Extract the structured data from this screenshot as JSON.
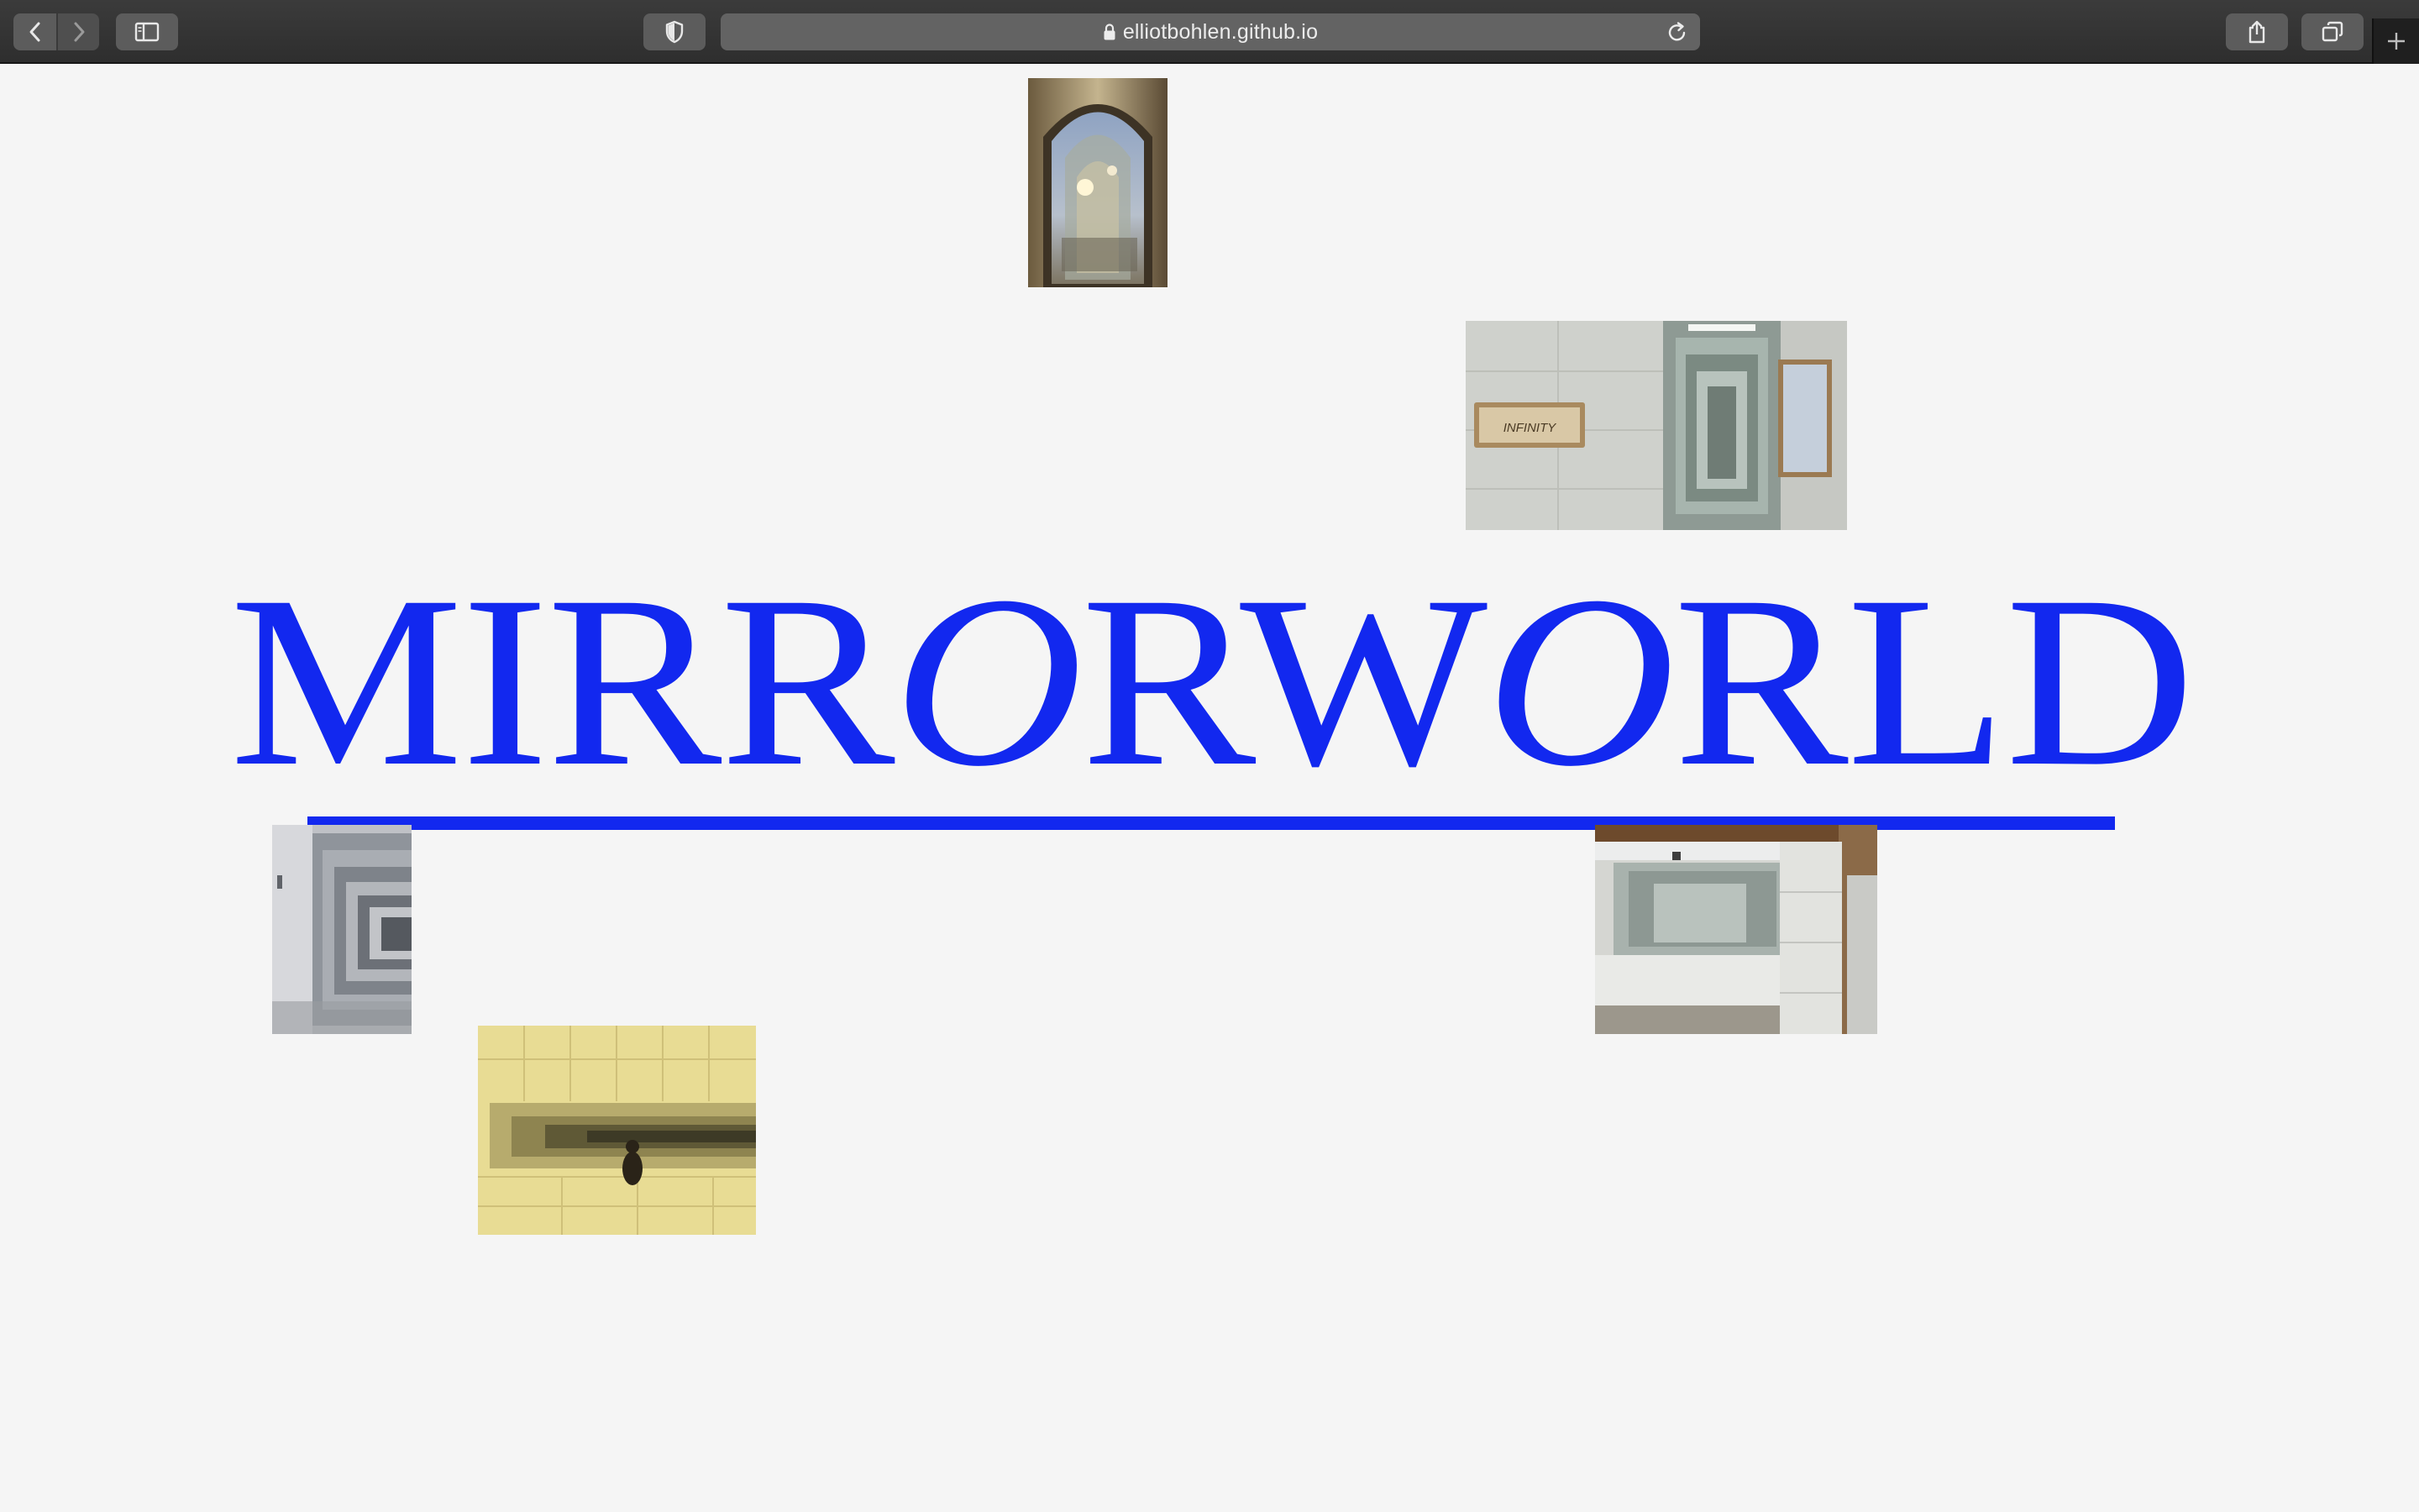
{
  "browser": {
    "url": "elliotbohlen.github.io",
    "icons": {
      "back": "chevron-left-icon",
      "forward": "chevron-right-icon",
      "sidebar": "sidebar-icon",
      "privacy": "shield-icon",
      "lock": "lock-icon",
      "reload": "reload-icon",
      "share": "share-icon",
      "tabs": "tabs-overview-icon",
      "new_tab": "plus-icon"
    }
  },
  "page": {
    "background": "#f5f5f5",
    "title": {
      "parts": [
        {
          "text": "MIRR",
          "italic": false
        },
        {
          "text": "O",
          "italic": true
        },
        {
          "text": "RW",
          "italic": false
        },
        {
          "text": "O",
          "italic": true
        },
        {
          "text": "RLD",
          "italic": false
        }
      ],
      "color": "#1228ef"
    },
    "photos": [
      {
        "name": "arched-mirror-photo"
      },
      {
        "name": "infinity-sign-photo"
      },
      {
        "name": "mirror-corridor-photo"
      },
      {
        "name": "yellow-tile-mirror-photo"
      },
      {
        "name": "bathroom-mirror-photo"
      }
    ]
  }
}
